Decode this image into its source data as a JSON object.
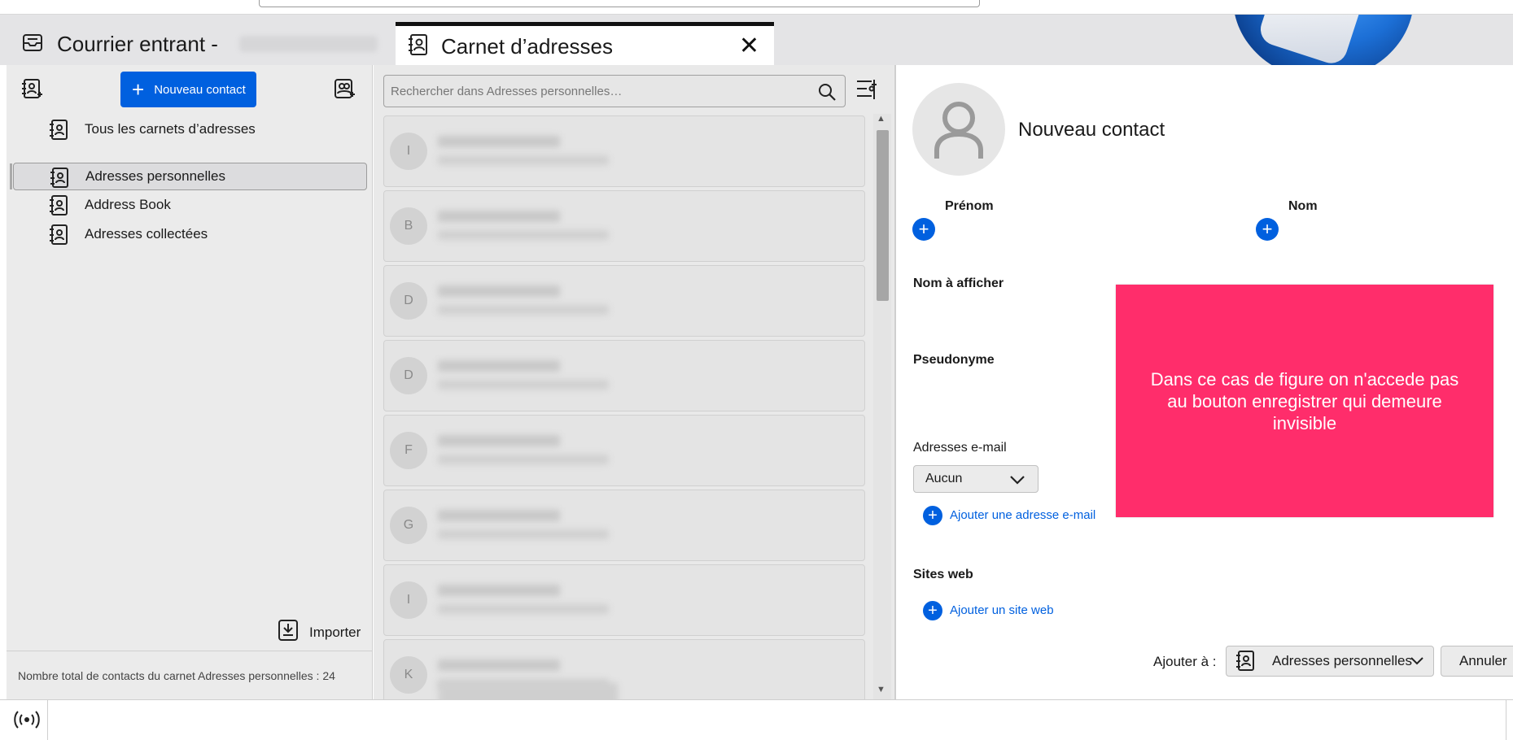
{
  "tabs": {
    "mail_title": "Courrier entrant -",
    "addressbook_title": "Carnet d’adresses",
    "close_symbol": "✕"
  },
  "toolbar": {
    "new_contact_label": "Nouveau contact"
  },
  "sidebar": {
    "items": [
      {
        "label": "Tous les carnets d’adresses",
        "selected": false
      },
      {
        "label": "Adresses personnelles",
        "selected": true
      },
      {
        "label": "Address Book",
        "selected": false
      },
      {
        "label": "Adresses collectées",
        "selected": false
      }
    ],
    "import_label": "Importer",
    "total_text": "Nombre total de contacts du carnet Adresses personnelles : 24"
  },
  "search": {
    "placeholder": "Rechercher dans Adresses personnelles…"
  },
  "contact_list": {
    "initials": [
      "I",
      "B",
      "D",
      "D",
      "F",
      "G",
      "I",
      "K"
    ]
  },
  "contact_form": {
    "display_name": "Nouveau contact",
    "first_name_label": "Prénom",
    "last_name_label": "Nom",
    "display_name_label": "Nom à afficher",
    "nickname_label": "Pseudonyme",
    "emails_label": "Adresses e-mail",
    "email_type_value": "Aucun",
    "add_email_label": "Ajouter une adresse e-mail",
    "websites_label": "Sites web",
    "add_website_label": "Ajouter un site web",
    "add_to_label": "Ajouter à :",
    "add_to_value": "Adresses personnelles",
    "cancel_label": "Annuler"
  },
  "annotation": {
    "text": "Dans ce cas de figure on n'accede pas au bouton enregistrer qui demeure invisible",
    "color": "#ff2d6b"
  },
  "colors": {
    "accent": "#0060df"
  },
  "icons": {
    "new_book": "address-book-add-icon",
    "new_list": "contact-list-add-icon",
    "book": "address-book-icon",
    "search": "search-icon",
    "list_options": "list-options-icon",
    "import": "import-icon",
    "status": "online-status-icon"
  }
}
